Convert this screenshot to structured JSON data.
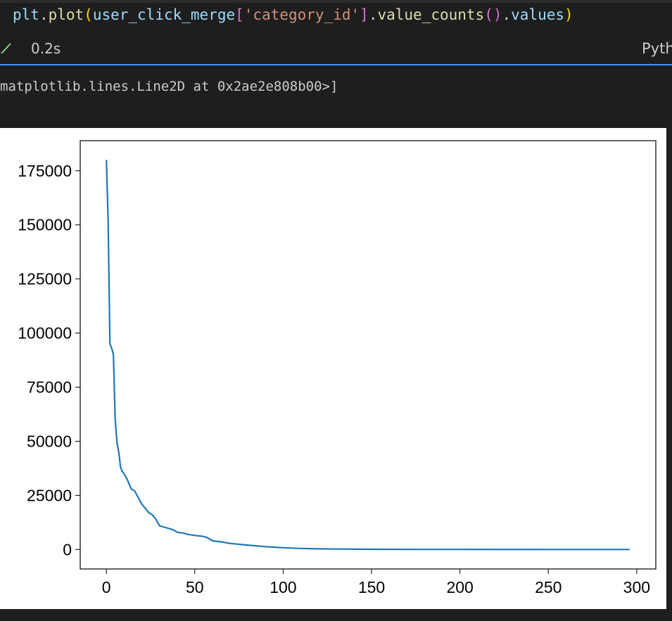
{
  "code": {
    "var": "plt",
    "dot1": ".",
    "fn_plot": "plot",
    "paren_open": "(",
    "arg_var": "user_click_merge",
    "bracket_open": "[",
    "key_str": "'category_id'",
    "bracket_close": "]",
    "dot2": ".",
    "fn_value_counts": "value_counts",
    "call_parens": "()",
    "dot3": ".",
    "attr_values": "values",
    "paren_close": ")"
  },
  "status": {
    "exec_time": "0.2s",
    "kernel_label": "Pyth",
    "check_icon": "check-icon",
    "success_color": "#89d185"
  },
  "output": {
    "text": "matplotlib.lines.Line2D at 0x2ae2e808b00>]"
  },
  "chart_data": {
    "type": "line",
    "title": "",
    "xlabel": "",
    "ylabel": "",
    "xlim": [
      -14.8,
      310.8
    ],
    "ylim": [
      -9000,
      188900
    ],
    "xticks": [
      0,
      50,
      100,
      150,
      200,
      250,
      300
    ],
    "xtick_labels": [
      "0",
      "50",
      "100",
      "150",
      "200",
      "250",
      "300"
    ],
    "yticks": [
      0,
      25000,
      50000,
      75000,
      100000,
      125000,
      150000,
      175000
    ],
    "ytick_labels": [
      "0",
      "25000",
      "50000",
      "75000",
      "100000",
      "125000",
      "150000",
      "175000"
    ],
    "grid": false,
    "line_color": "#1f77b4",
    "series": [
      {
        "x": [
          0,
          1,
          2,
          3,
          4,
          5,
          6,
          7,
          8,
          9,
          10,
          12,
          14,
          16,
          18,
          20,
          22,
          24,
          26,
          28,
          30,
          34,
          38,
          40,
          44,
          46,
          50,
          55,
          57,
          60,
          65,
          70,
          80,
          90,
          100,
          110,
          120,
          130,
          150,
          175,
          200,
          250,
          296
        ],
        "y": [
          180000,
          152000,
          95000,
          93000,
          90000,
          60000,
          49000,
          45000,
          38000,
          36000,
          35000,
          32000,
          28000,
          27000,
          24000,
          21000,
          19000,
          17000,
          16000,
          14000,
          11000,
          10000,
          9000,
          8000,
          7500,
          7000,
          6500,
          6000,
          5500,
          4000,
          3500,
          2800,
          2000,
          1300,
          800,
          500,
          300,
          200,
          100,
          50,
          20,
          5,
          0
        ]
      }
    ]
  }
}
